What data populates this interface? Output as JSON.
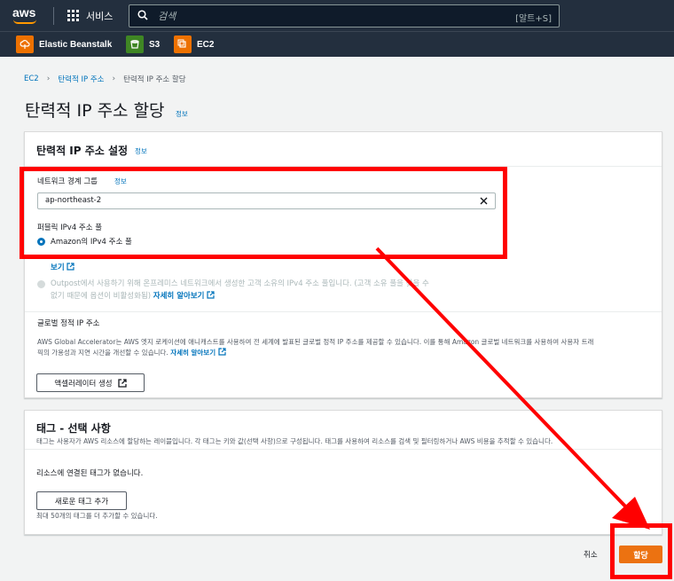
{
  "topnav": {
    "logo_text": "aws",
    "services_label": "서비스",
    "search_placeholder": "검색",
    "search_shortcut": "[알트+S]"
  },
  "favorites": [
    {
      "label": "Elastic Beanstalk",
      "icon": "elastic-beanstalk-icon",
      "color": "#ed7100"
    },
    {
      "label": "S3",
      "icon": "s3-bucket-icon",
      "color": "#3f8624"
    },
    {
      "label": "EC2",
      "icon": "ec2-icon",
      "color": "#ed7100"
    }
  ],
  "breadcrumb": {
    "items": [
      "EC2",
      "탄력적 IP 주소",
      "탄력적 IP 주소 할당"
    ]
  },
  "page": {
    "title": "탄력적 IP 주소 할당",
    "info": "정보"
  },
  "settings_panel": {
    "title": "탄력적 IP 주소 설정",
    "info": "정보",
    "network_border_group_label": "네트워크 경계 그룹",
    "network_border_group_info": "정보",
    "network_border_group_value": "ap-northeast-2",
    "public_ipv4_pool_label": "퍼블릭 IPv4 주소 풀",
    "option_amazon": "Amazon의 IPv4 주소 풀",
    "option_byoip_tail": "보기",
    "option_outpost_line1": "Outpost에서 사용하기 위해 온프레미스 네트워크에서 생성한 고객 소유의 IPv4 주소 풀입니다. (고객 소유 풀을 찾을 수",
    "option_outpost_line2": "없기 때문에 옵션이 비활성화됨)",
    "option_outpost_link": "자세히 알아보기",
    "global_static_ip_label": "글로벌 정적 IP 주소",
    "global_desc_line1": "AWS Global Accelerator는 AWS 엣지 로케이션에 애니캐스트를 사용하여 전 세계에 발표된 글로벌 정적 IP 주소를 제공할 수 있습니다. 이를 통해 Amazon 글로벌 네트워크를 사용하여 사용자 트래",
    "global_desc_line2": "픽의 가용성과 지연 시간을 개선할 수 있습니다.",
    "global_desc_link": "자세히 알아보기",
    "accelerator_button": "액셀러레이터 생성"
  },
  "tags_panel": {
    "title": "태그 - 선택 사항",
    "description": "태그는 사용자가 AWS 리소스에 할당하는 레이블입니다. 각 태그는 키와 값(선택 사항)으로 구성됩니다. 태그를 사용하여 리소스를 검색 및 필터링하거나 AWS 비용을 추적할 수 있습니다.",
    "empty_text": "리소스에 연결된 태그가 없습니다.",
    "add_tag_button": "새로운 태그 추가",
    "limit_text": "최대 50개의 태그를 더 추가할 수 있습니다."
  },
  "footer": {
    "cancel_label": "취소",
    "submit_label": "할당"
  },
  "colors": {
    "nav_bg": "#232f3e",
    "link": "#0073bb",
    "primary": "#ec7211",
    "annotation": "#ff0000"
  }
}
